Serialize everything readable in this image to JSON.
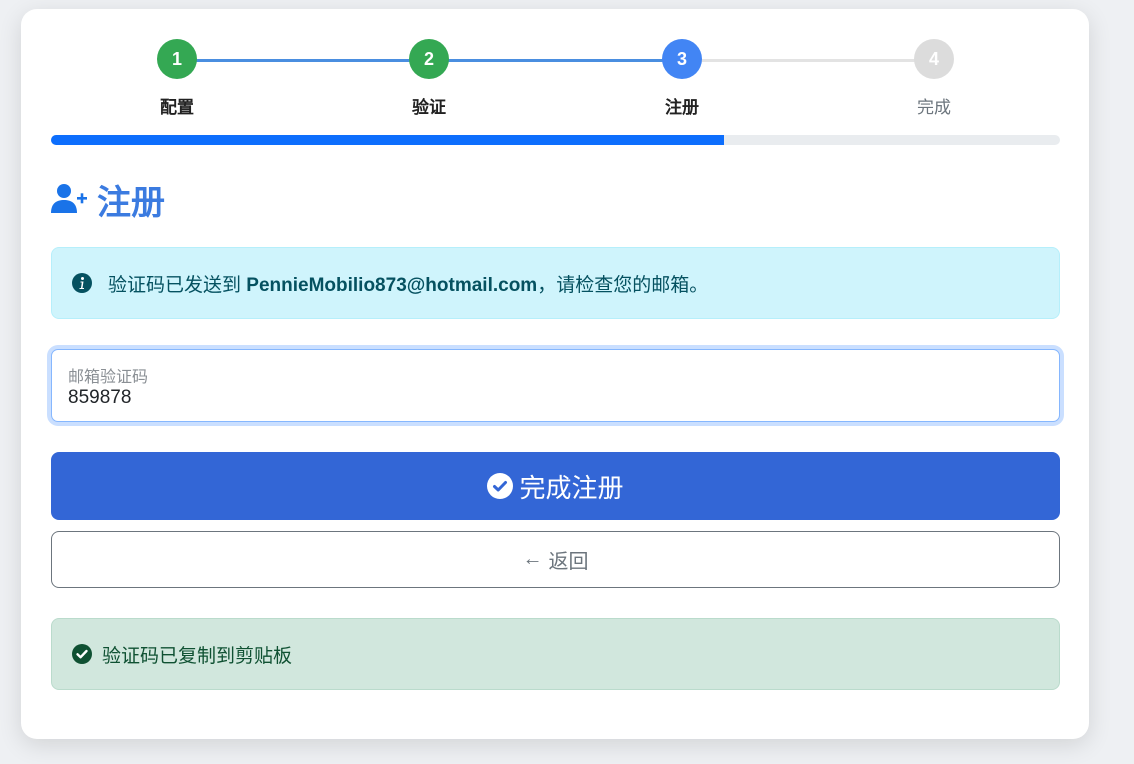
{
  "stepper": {
    "steps": [
      {
        "number": "1",
        "label": "配置",
        "state": "done"
      },
      {
        "number": "2",
        "label": "验证",
        "state": "done"
      },
      {
        "number": "3",
        "label": "注册",
        "state": "active"
      },
      {
        "number": "4",
        "label": "完成",
        "state": "pending"
      }
    ],
    "progress_percent": 66.7
  },
  "colors": {
    "done": "#34a853",
    "active": "#4285f4",
    "pending": "#dcdcdc",
    "primary": "#3366d6",
    "title": "#3b7be0"
  },
  "page": {
    "title": "注册",
    "title_icon": "user-plus-icon"
  },
  "info_alert": {
    "icon": "info-circle-icon",
    "prefix": "验证码已发送到 ",
    "email": "PennieMobilio873@hotmail.com",
    "suffix": "，请检查您的邮箱。"
  },
  "code_field": {
    "label": "邮箱验证码",
    "value": "859878"
  },
  "buttons": {
    "submit_label": "完成注册",
    "submit_icon": "check-circle-icon",
    "back_label": "返回",
    "back_icon": "arrow-left-icon"
  },
  "success_alert": {
    "icon": "check-circle-icon",
    "text": "验证码已复制到剪贴板"
  }
}
